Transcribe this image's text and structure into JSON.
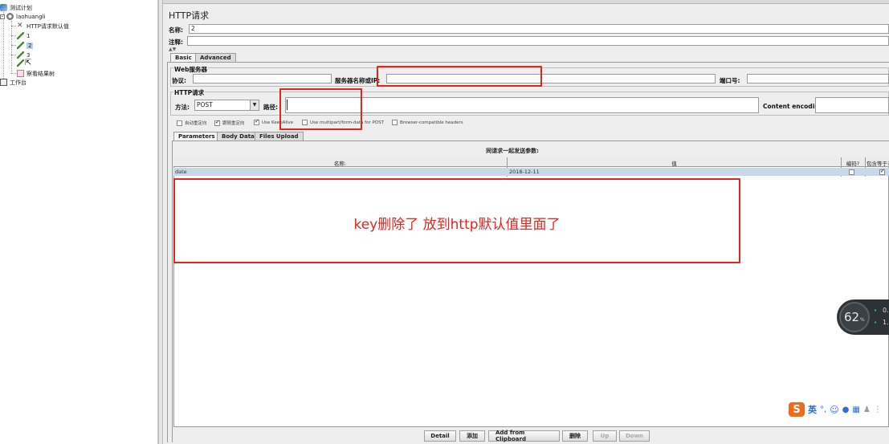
{
  "tree": {
    "test_plan": "测试计划",
    "thread_group": "laohuangli",
    "http_defaults": "HTTP请求默认值",
    "sampler_1": "1",
    "sampler_2": "2",
    "sampler_3": "3",
    "result_tree": "察看结果树",
    "workbench": "工作台"
  },
  "panel": {
    "title": "HTTP请求",
    "name_label": "名称:",
    "name_value": "2",
    "comment_label": "注释:",
    "tabs": [
      "Basic",
      "Advanced"
    ],
    "web_server_group": "Web服务器",
    "protocol_label": "协议:",
    "server_label": "服务器名称或IP:",
    "port_label": "端口号:",
    "http_request_group": "HTTP请求",
    "method_label": "方法:",
    "method_value": "POST",
    "path_label": "路径:",
    "content_encoding_label": "Content encoding:",
    "checkboxes": [
      {
        "label": "自动重定向",
        "checked": false
      },
      {
        "label": "跟随重定向",
        "checked": true
      },
      {
        "label": "Use KeepAlive",
        "checked": true
      },
      {
        "label": "Use multipart/form-data for POST",
        "checked": false
      },
      {
        "label": "Browser-compatible headers",
        "checked": false
      }
    ],
    "sub_tabs": [
      "Parameters",
      "Body Data",
      "Files Upload"
    ],
    "params_caption": "同请求一起发送参数:",
    "table_headers": [
      "名称:",
      "值",
      "编码?",
      "包含等于?"
    ],
    "rows": [
      {
        "name": "date",
        "value": "2018-12-11",
        "encode": false,
        "include_equals": true
      }
    ],
    "buttons": [
      "Detail",
      "添加",
      "Add from Clipboard",
      "删除",
      "Up",
      "Down"
    ]
  },
  "annotation": "key删除了 放到http默认值里面了",
  "widget": {
    "percent": "62",
    "unit": "%",
    "line1": "0.",
    "line2": "1."
  },
  "ime": {
    "lang": "英"
  }
}
